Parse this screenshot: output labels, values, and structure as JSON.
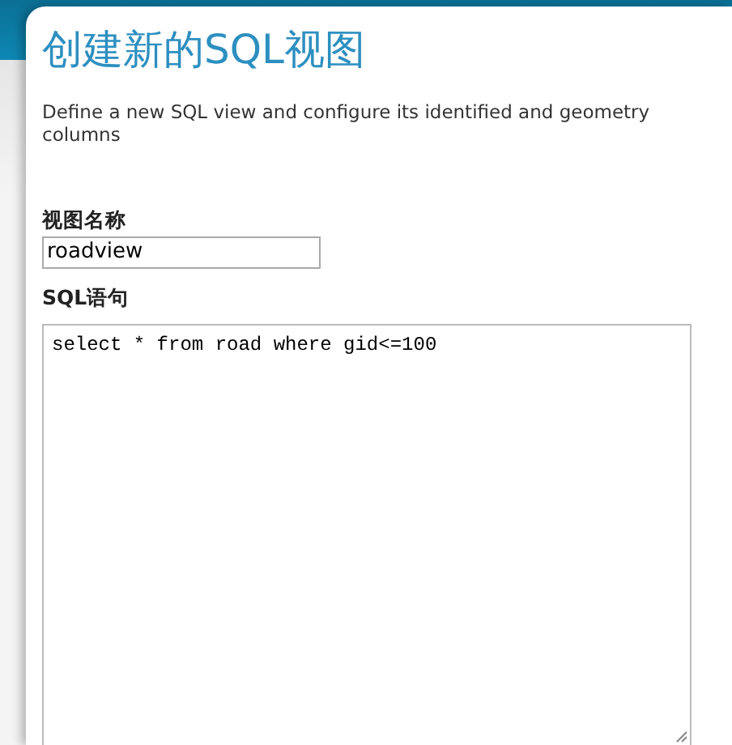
{
  "title": "创建新的SQL视图",
  "description": "Define a new SQL view and configure its identified and geometry columns",
  "name_field": {
    "label": "视图名称",
    "value": "roadview"
  },
  "sql_field": {
    "label": "SQL语句",
    "value": "select * from road where gid<=100"
  }
}
